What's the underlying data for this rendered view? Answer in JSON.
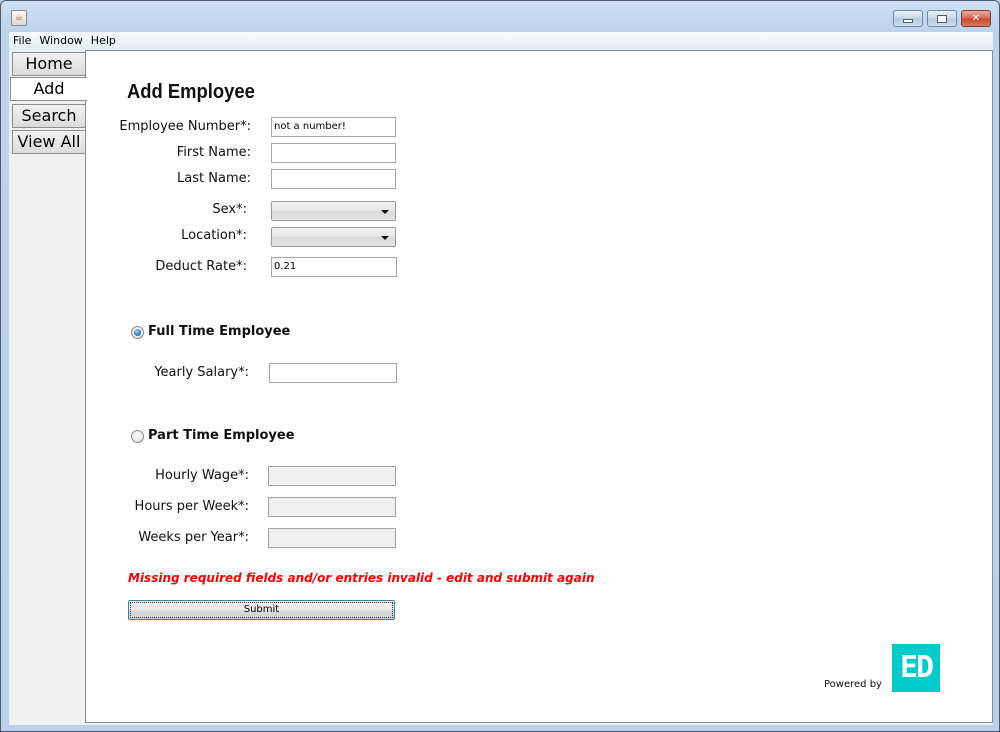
{
  "window": {
    "title": "",
    "app_icon": "java-icon",
    "controls": {
      "minimize": "minimize-icon",
      "maximize": "maximize-icon",
      "close": "close-icon",
      "close_glyph": "✕"
    }
  },
  "menubar": {
    "items": [
      "File",
      "Window",
      "Help"
    ]
  },
  "sidebar": {
    "tabs": [
      {
        "label": "Home",
        "selected": false
      },
      {
        "label": "Add",
        "selected": true
      },
      {
        "label": "Search",
        "selected": false
      },
      {
        "label": "View All",
        "selected": false
      }
    ]
  },
  "form": {
    "title": "Add Employee",
    "fields": {
      "employee_number": {
        "label": "Employee Number*:",
        "value": "not a number!"
      },
      "first_name": {
        "label": "First Name:",
        "value": ""
      },
      "last_name": {
        "label": "Last Name:",
        "value": ""
      },
      "sex": {
        "label": "Sex*:",
        "selected": ""
      },
      "location": {
        "label": "Location*:",
        "selected": ""
      },
      "deduct_rate": {
        "label": "Deduct Rate*:",
        "value": "0.21"
      }
    },
    "full_time": {
      "label": "Full Time Employee",
      "checked": true,
      "yearly_salary": {
        "label": "Yearly Salary*:",
        "value": ""
      }
    },
    "part_time": {
      "label": "Part Time Employee",
      "checked": false,
      "hourly_wage": {
        "label": "Hourly Wage*:",
        "value": "",
        "enabled": false
      },
      "hours_per_week": {
        "label": "Hours per Week*:",
        "value": "",
        "enabled": false
      },
      "weeks_per_year": {
        "label": "Weeks per Year*:",
        "value": "",
        "enabled": false
      }
    },
    "error_message": "Missing required fields and/or entries invalid - edit and submit again",
    "submit_label": "Submit"
  },
  "footer": {
    "powered_by": "Powered by",
    "logo_text": "ED"
  },
  "colors": {
    "error": "#ff0000",
    "logo_bg": "#00cccc",
    "window_frame": "#b9d1ea"
  }
}
